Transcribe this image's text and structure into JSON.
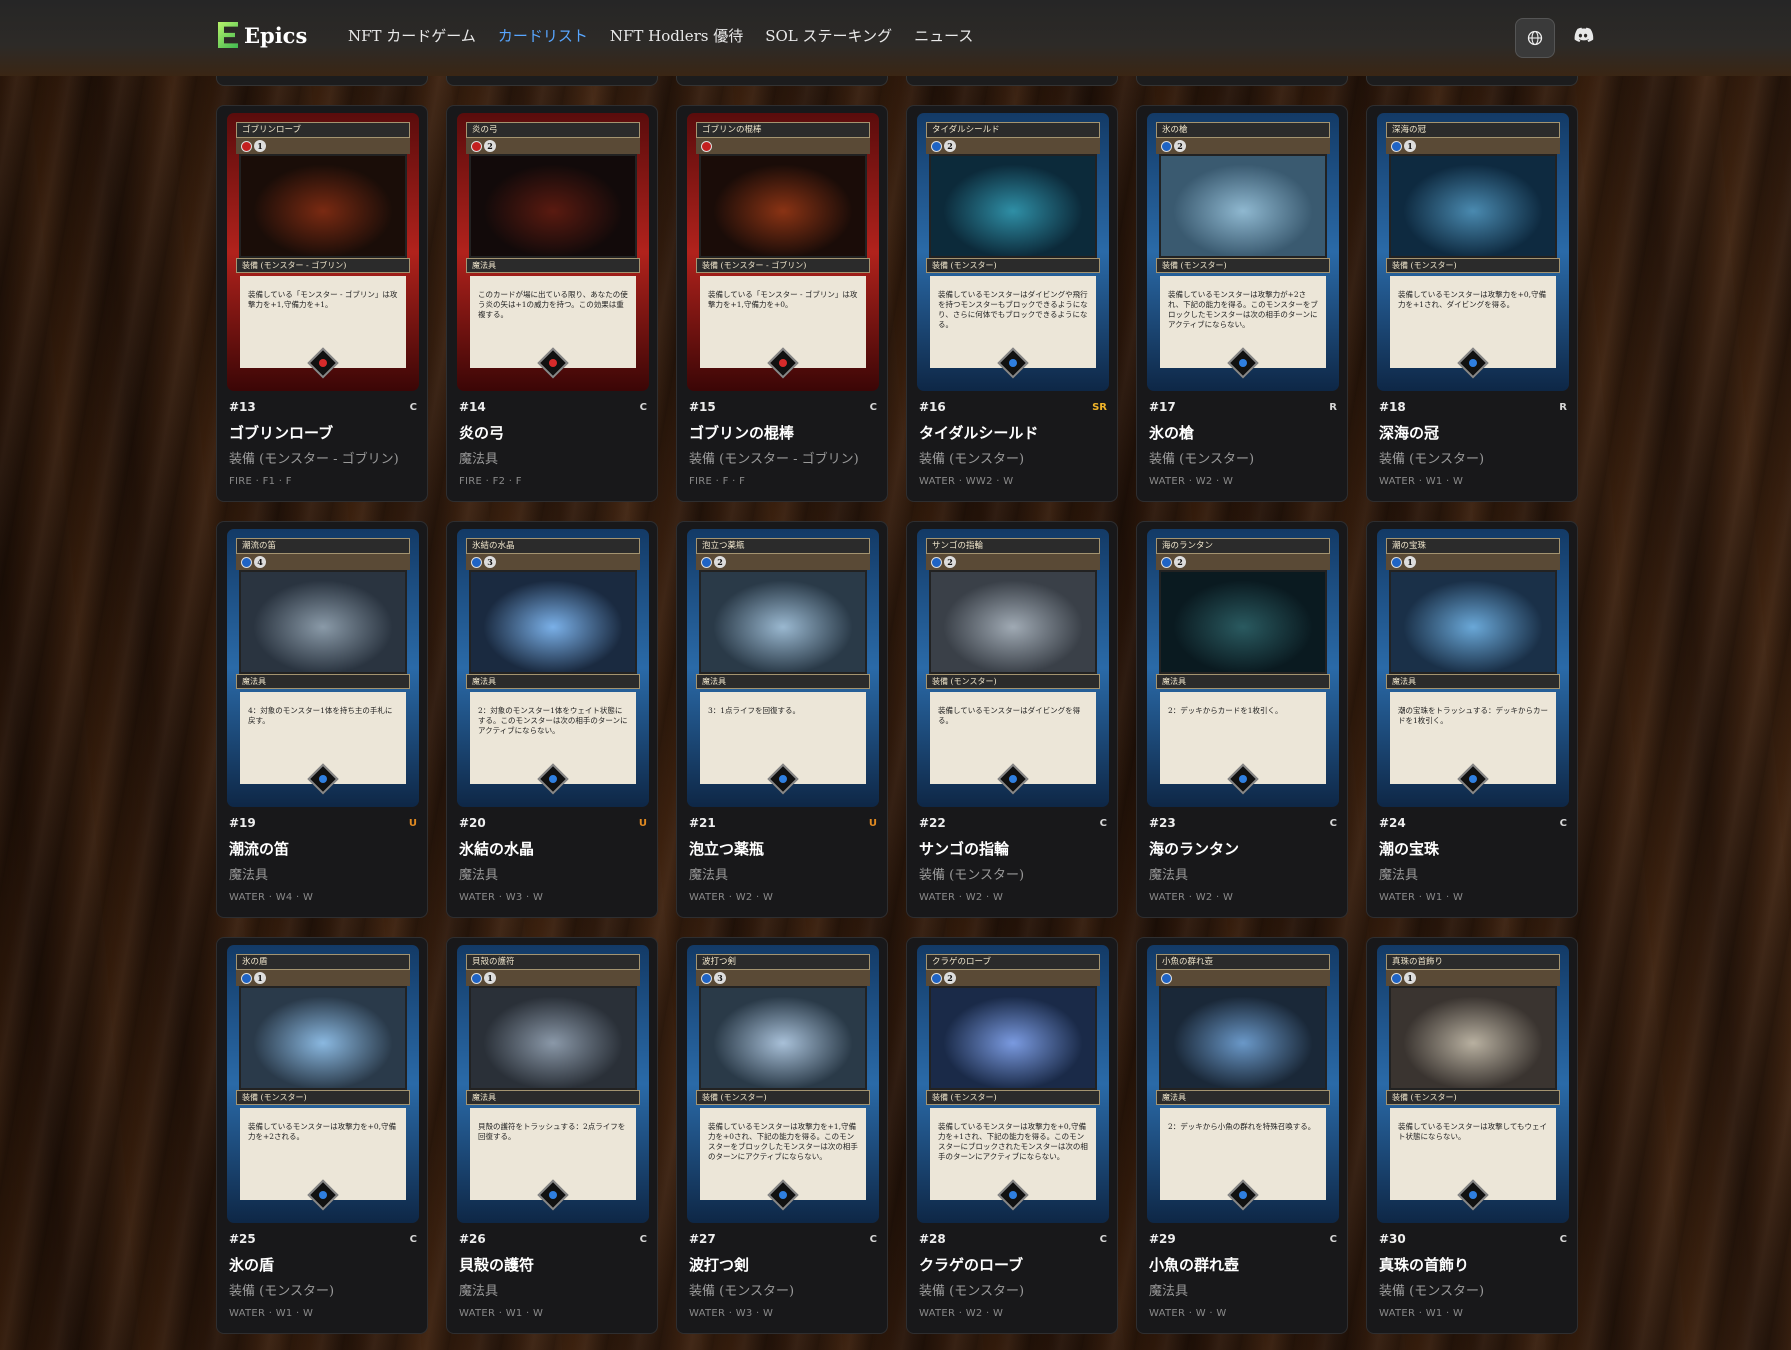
{
  "header": {
    "logo_text": "Epics",
    "nav": [
      "NFT カードゲーム",
      "カードリスト",
      "NFT Hodlers 優待",
      "SOL ステーキング",
      "ニュース"
    ],
    "active_nav": "カードリスト",
    "globe_icon": "globe-icon",
    "discord_icon": "discord-icon"
  },
  "colors": {
    "accent": "#58a6ff",
    "fire": "#b1221c",
    "water": "#2a6aa8",
    "rarity_uncommon": "#e08a22",
    "rarity_super_rare": "#f0b429"
  },
  "cards": [
    {
      "num": "#13",
      "rarity": "C",
      "name": "ゴブリンローブ",
      "type": "装備 (モンスター - ゴブリン)",
      "meta": "FIRE · F1 · F",
      "element": "fire",
      "mana": "1",
      "art": [
        "#1a0d08",
        "#7a2a12",
        "#2a140a"
      ],
      "card_type": "装備 (モンスター - ゴブリン)",
      "text": "装備している「モンスター - ゴブリン」は攻撃力を+1,守備力を+1。"
    },
    {
      "num": "#14",
      "rarity": "C",
      "name": "炎の弓",
      "type": "魔法具",
      "meta": "FIRE · F2 · F",
      "element": "fire",
      "mana": "2",
      "art": [
        "#120a0a",
        "#5a1a10",
        "#1a0d0a"
      ],
      "card_type": "魔法具",
      "text": "このカードが場に出ている限り、あなたの使う炎の矢は+1の威力を持つ。この効果は重複する。"
    },
    {
      "num": "#15",
      "rarity": "C",
      "name": "ゴブリンの棍棒",
      "type": "装備 (モンスター - ゴブリン)",
      "meta": "FIRE · F · F",
      "element": "fire",
      "mana": "",
      "art": [
        "#1a0c08",
        "#8a3314",
        "#24110a"
      ],
      "card_type": "装備 (モンスター - ゴブリン)",
      "text": "装備している「モンスター - ゴブリン」は攻撃力を+1,守備力を+0。"
    },
    {
      "num": "#16",
      "rarity": "SR",
      "name": "タイダルシールド",
      "type": "装備 (モンスター)",
      "meta": "WATER · WW2 · W",
      "element": "water",
      "mana": "2",
      "art": [
        "#0c2a3a",
        "#2f8fa6",
        "#0a3340"
      ],
      "card_type": "装備 (モンスター)",
      "text": "装備しているモンスターはダイビングや飛行を持つモンスターもブロックできるようになり、さらに何体でもブロックできるようになる。"
    },
    {
      "num": "#17",
      "rarity": "R",
      "name": "氷の槍",
      "type": "装備 (モンスター)",
      "meta": "WATER · W2 · W",
      "element": "water",
      "mana": "2",
      "art": [
        "#3a5a70",
        "#8fb8d0",
        "#2a4a60"
      ],
      "card_type": "装備 (モンスター)",
      "text": "装備しているモンスターは攻撃力が+2され、下記の能力を得る。このモンスターをブロックしたモンスターは次の相手のターンにアクティブにならない。"
    },
    {
      "num": "#18",
      "rarity": "R",
      "name": "深海の冠",
      "type": "装備 (モンスター)",
      "meta": "WATER · W1 · W",
      "element": "water",
      "mana": "1",
      "art": [
        "#0e2a40",
        "#4a8ab0",
        "#12324a"
      ],
      "card_type": "装備 (モンスター)",
      "text": "装備しているモンスターは攻撃力を+0,守備力を+1され、ダイビングを得る。"
    },
    {
      "num": "#19",
      "rarity": "U",
      "name": "潮流の笛",
      "type": "魔法具",
      "meta": "WATER · W4 · W",
      "element": "water",
      "mana": "4",
      "art": [
        "#2a3440",
        "#8a9aa8",
        "#3a2a20"
      ],
      "card_type": "魔法具",
      "text": "4：対象のモンスター1体を持ち主の手札に戻す。"
    },
    {
      "num": "#20",
      "rarity": "U",
      "name": "氷結の水晶",
      "type": "魔法具",
      "meta": "WATER · W3 · W",
      "element": "water",
      "mana": "3",
      "art": [
        "#1a2a40",
        "#7ab0e8",
        "#2a3a50"
      ],
      "card_type": "魔法具",
      "text": "2：対象のモンスター1体をウェイト状態にする。このモンスターは次の相手のターンにアクティブにならない。"
    },
    {
      "num": "#21",
      "rarity": "U",
      "name": "泡立つ薬瓶",
      "type": "魔法具",
      "meta": "WATER · W2 · W",
      "element": "water",
      "mana": "2",
      "art": [
        "#2a3a48",
        "#9ab8d0",
        "#3a3a3a"
      ],
      "card_type": "魔法具",
      "text": "3：1点ライフを回復する。"
    },
    {
      "num": "#22",
      "rarity": "C",
      "name": "サンゴの指輪",
      "type": "装備 (モンスター)",
      "meta": "WATER · W2 · W",
      "element": "water",
      "mana": "2",
      "art": [
        "#3a4048",
        "#a0aab4",
        "#4a4038"
      ],
      "card_type": "装備 (モンスター)",
      "text": "装備しているモンスターはダイビングを得る。"
    },
    {
      "num": "#23",
      "rarity": "C",
      "name": "海のランタン",
      "type": "魔法具",
      "meta": "WATER · W2 · W",
      "element": "water",
      "mana": "2",
      "art": [
        "#0a1a20",
        "#2a5a60",
        "#c08a30"
      ],
      "card_type": "魔法具",
      "text": "2：デッキからカードを1枚引く。"
    },
    {
      "num": "#24",
      "rarity": "C",
      "name": "潮の宝珠",
      "type": "魔法具",
      "meta": "WATER · W1 · W",
      "element": "water",
      "mana": "1",
      "art": [
        "#1a3048",
        "#6aa8d8",
        "#2a3a48"
      ],
      "card_type": "魔法具",
      "text": "潮の宝珠をトラッシュする：デッキからカードを1枚引く。"
    },
    {
      "num": "#25",
      "rarity": "C",
      "name": "氷の盾",
      "type": "装備 (モンスター)",
      "meta": "WATER · W1 · W",
      "element": "water",
      "mana": "1",
      "art": [
        "#2a3a4a",
        "#8ab8e0",
        "#3a4a58"
      ],
      "card_type": "装備 (モンスター)",
      "text": "装備しているモンスターは攻撃力を+0,守備力を+2される。"
    },
    {
      "num": "#26",
      "rarity": "C",
      "name": "貝殻の護符",
      "type": "魔法具",
      "meta": "WATER · W1 · W",
      "element": "water",
      "mana": "1",
      "art": [
        "#2a3038",
        "#8a98a8",
        "#5a4a30"
      ],
      "card_type": "魔法具",
      "text": "貝殻の護符をトラッシュする：2点ライフを回復する。"
    },
    {
      "num": "#27",
      "rarity": "C",
      "name": "波打つ剣",
      "type": "装備 (モンスター)",
      "meta": "WATER · W3 · W",
      "element": "water",
      "mana": "3",
      "art": [
        "#2a3a48",
        "#a8c0d8",
        "#3a4450"
      ],
      "card_type": "装備 (モンスター)",
      "text": "装備しているモンスターは攻撃力を+1,守備力を+0され、下記の能力を得る。このモンスターをブロックしたモンスターは次の相手のターンにアクティブにならない。"
    },
    {
      "num": "#28",
      "rarity": "C",
      "name": "クラゲのローブ",
      "type": "装備 (モンスター)",
      "meta": "WATER · W2 · W",
      "element": "water",
      "mana": "2",
      "art": [
        "#1a2a48",
        "#7a9ae0",
        "#2a3058"
      ],
      "card_type": "装備 (モンスター)",
      "text": "装備しているモンスターは攻撃力を+0,守備力を+1され、下記の能力を得る。このモンスターにブロックされたモンスターは次の相手のターンにアクティブにならない。"
    },
    {
      "num": "#29",
      "rarity": "C",
      "name": "小魚の群れ壺",
      "type": "魔法具",
      "meta": "WATER · W · W",
      "element": "water",
      "mana": "",
      "art": [
        "#1a2838",
        "#6a98c8",
        "#2a3848"
      ],
      "card_type": "魔法具",
      "text": "2：デッキから小魚の群れを特殊召喚する。"
    },
    {
      "num": "#30",
      "rarity": "C",
      "name": "真珠の首飾り",
      "type": "装備 (モンスター)",
      "meta": "WATER · W1 · W",
      "element": "water",
      "mana": "1",
      "art": [
        "#3a3430",
        "#b8b0a0",
        "#4a3a30"
      ],
      "card_type": "装備 (モンスター)",
      "text": "装備しているモンスターは攻撃してもウェイト状態にならない。"
    }
  ]
}
